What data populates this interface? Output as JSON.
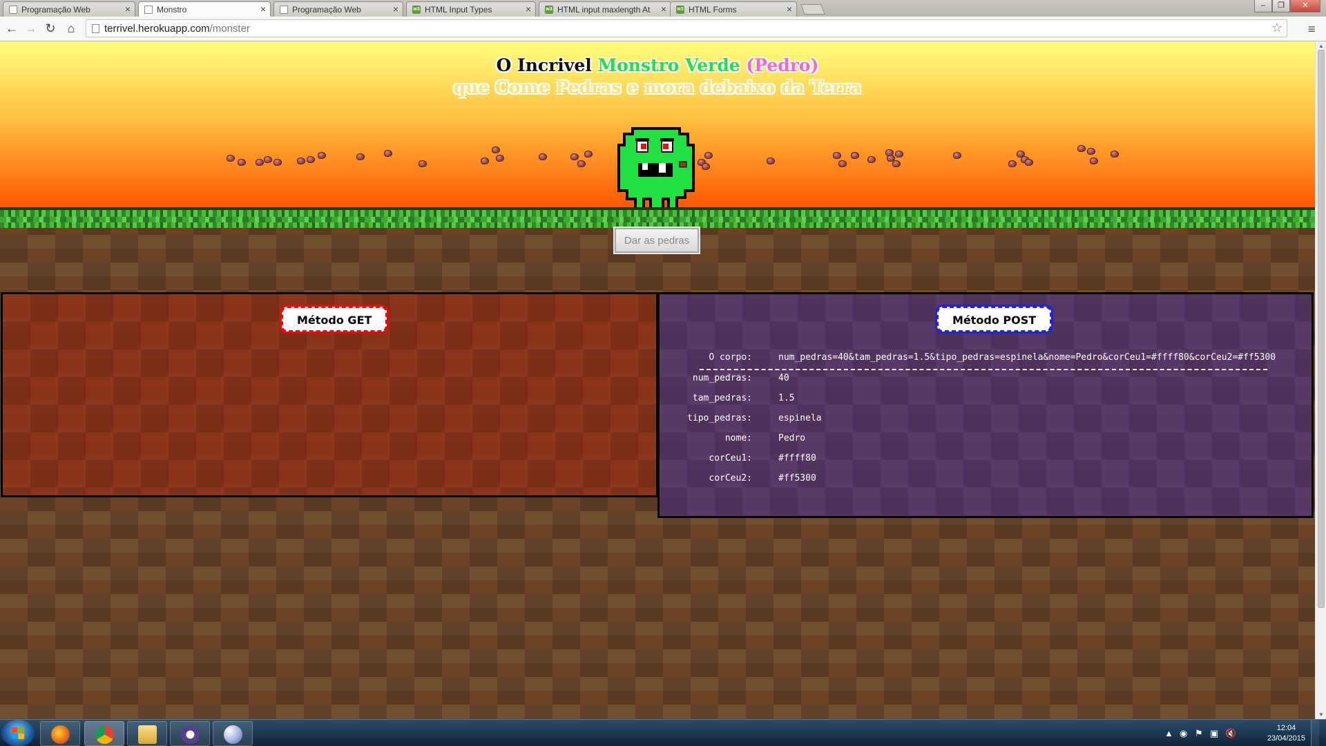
{
  "browser": {
    "tabs": [
      {
        "label": "Programação Web",
        "icon": "page-icon"
      },
      {
        "label": "Monstro",
        "icon": "page-icon"
      },
      {
        "label": "Programação Web",
        "icon": "page-icon"
      },
      {
        "label": "HTML Input Types",
        "icon": "w3schools-icon"
      },
      {
        "label": "HTML input maxlength At",
        "icon": "w3schools-icon"
      },
      {
        "label": "HTML Forms",
        "icon": "w3schools-icon"
      }
    ],
    "active_tab": 1,
    "url_host": "terrivel.herokuapp.com",
    "url_path": "/monster"
  },
  "page": {
    "title_line1_a": "O Incrivel ",
    "title_line1_b": "Monstro Verde",
    "title_line1_c": " (Pedro)",
    "title_line2": "que Come Pedras e mora debaixo da Terra",
    "feed_button_label": "Dar as pedras",
    "stone_count": 40
  },
  "get_panel": {
    "title": "Método GET"
  },
  "post_panel": {
    "title": "Método POST",
    "body_label": "O corpo:",
    "body_value": "num_pedras=40&tam_pedras=1.5&tipo_pedras=espinela&nome=Pedro&corCeu1=#ffff80&corCeu2=#ff5300",
    "fields": [
      {
        "key": "num_pedras:",
        "value": "40"
      },
      {
        "key": "tam_pedras:",
        "value": "1.5"
      },
      {
        "key": "tipo_pedras:",
        "value": "espinela"
      },
      {
        "key": "nome:",
        "value": "Pedro"
      },
      {
        "key": "corCeu1:",
        "value": "#ffff80"
      },
      {
        "key": "corCeu2:",
        "value": "#ff5300"
      }
    ]
  },
  "colors": {
    "sky_top": "#ffff80",
    "sky_bottom": "#ff5300",
    "monster_green": "#22e040",
    "get_panel": "#963219",
    "post_panel": "#553778"
  },
  "taskbar": {
    "apps": [
      "firefox-icon",
      "chrome-icon",
      "file-explorer-icon",
      "cat-app-icon",
      "paint-icon"
    ],
    "clock_time": "12:04",
    "clock_date": "23/04/2015"
  }
}
